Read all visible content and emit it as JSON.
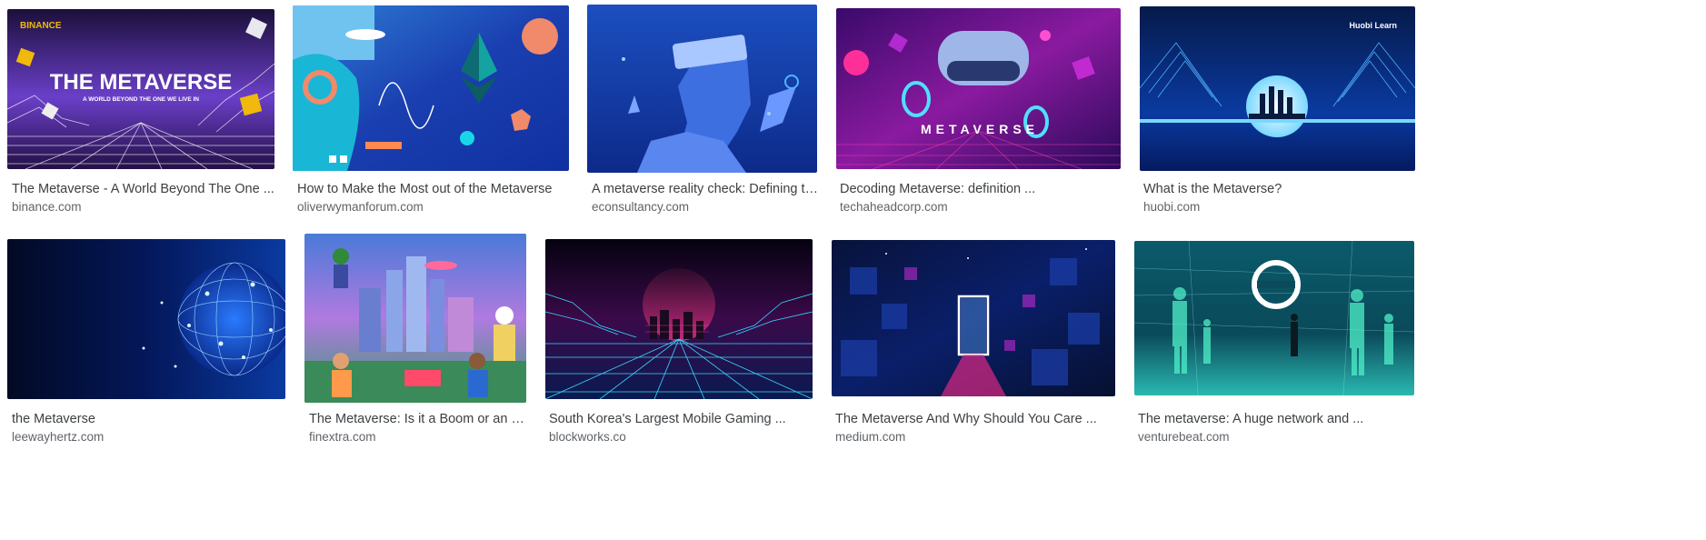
{
  "results": [
    {
      "title": "The Metaverse - A World Beyond The One ...",
      "source": "binance.com",
      "thumb_heading": "THE METAVERSE",
      "thumb_subheading": "A WORLD BEYOND THE ONE WE LIVE IN",
      "thumb_brand": "BINANCE"
    },
    {
      "title": "How to Make the Most out of the Metaverse",
      "source": "oliverwymanforum.com"
    },
    {
      "title": "A metaverse reality check: Defining the ...",
      "source": "econsultancy.com"
    },
    {
      "title": "Decoding Metaverse: definition ...",
      "source": "techaheadcorp.com",
      "thumb_text": "METAVERSE"
    },
    {
      "title": "What is the Metaverse?",
      "source": "huobi.com",
      "thumb_brand": "Huobi Learn"
    },
    {
      "title": "the Metaverse",
      "source": "leewayhertz.com"
    },
    {
      "title": "The Metaverse: Is it a Boom or an Uphe...",
      "source": "finextra.com"
    },
    {
      "title": "South Korea's Largest Mobile Gaming ...",
      "source": "blockworks.co"
    },
    {
      "title": "The Metaverse And Why Should You Care ...",
      "source": "medium.com"
    },
    {
      "title": "The metaverse: A huge network and ...",
      "source": "venturebeat.com"
    }
  ]
}
